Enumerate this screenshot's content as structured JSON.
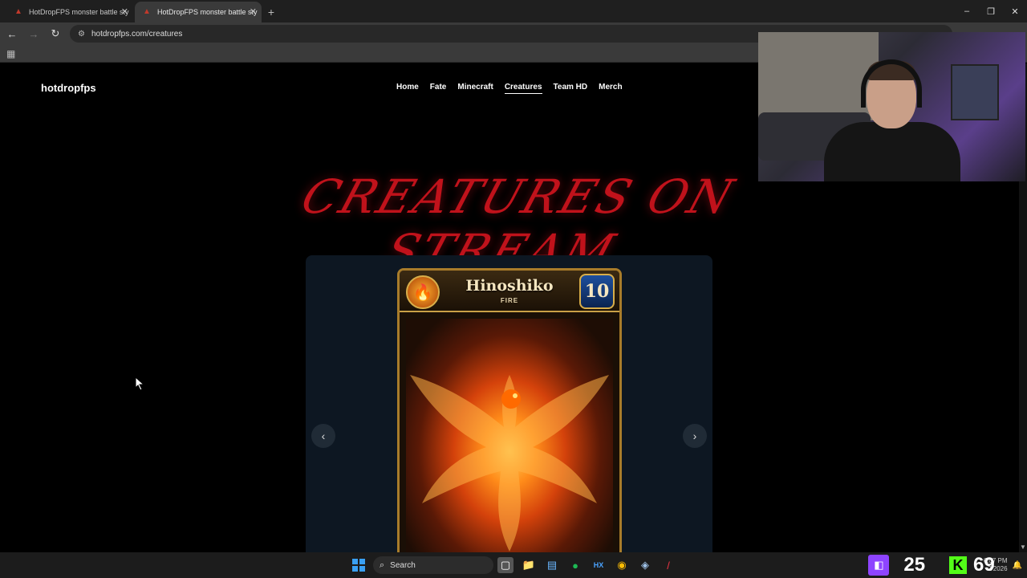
{
  "browser": {
    "tabs": [
      {
        "title": "HotDropFPS monster battle sty",
        "active": false
      },
      {
        "title": "HotDropFPS monster battle sty",
        "active": true
      }
    ],
    "new_tab": "+",
    "url": "hotdropfps.com/creatures",
    "window_controls": {
      "minimize": "–",
      "restore": "❐",
      "close": "✕"
    },
    "nav": {
      "back": "←",
      "forward": "→",
      "reload": "↻"
    }
  },
  "site": {
    "brand": "hotdropfps",
    "nav": [
      "Home",
      "Fate",
      "Minecraft",
      "Creatures",
      "Team HD",
      "Merch"
    ],
    "current_nav": "Creatures",
    "hero_title": "CREATURES ON STREAM",
    "carousel": {
      "prev": "‹",
      "next": "›",
      "card": {
        "name": "Hinoshiko",
        "type": "FIRE",
        "level": "10"
      }
    }
  },
  "taskbar": {
    "search_label": "Search",
    "tray": {
      "counter_1": "25",
      "counter_2": "69",
      "time": "6:07 PM",
      "date": "2/2026"
    }
  },
  "colors": {
    "accent_red": "#c0121b",
    "carousel_bg": "#0d1722",
    "twitch": "#8e44ff",
    "kick": "#53fc18"
  }
}
